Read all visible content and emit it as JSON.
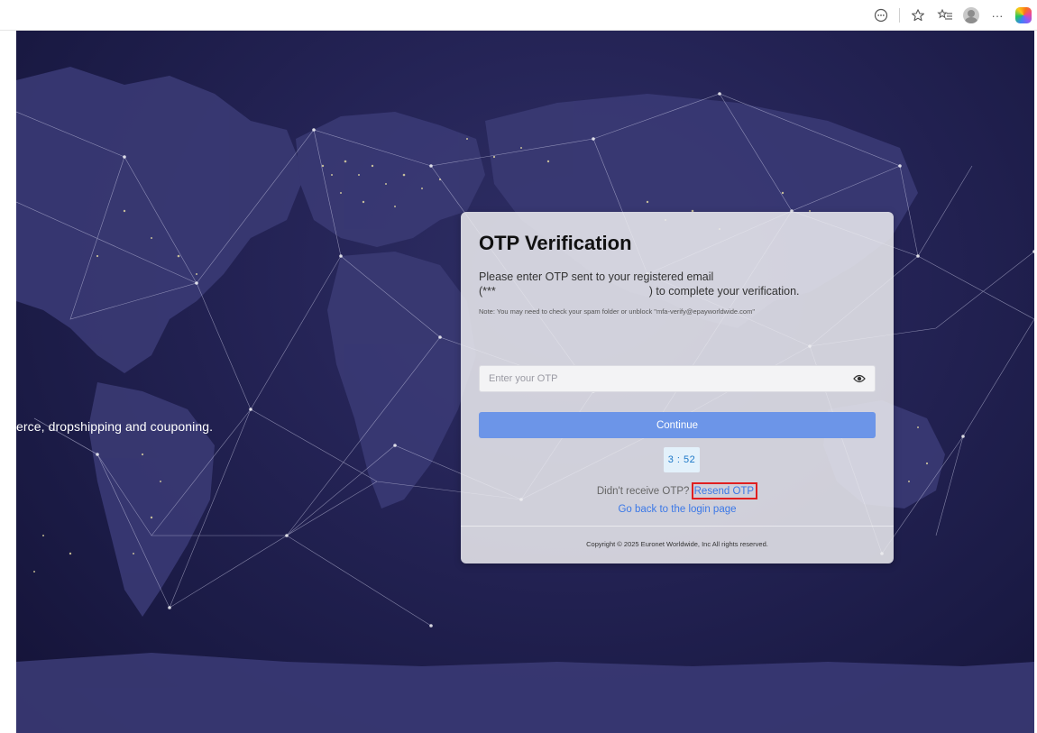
{
  "browser": {
    "icons": [
      "more-circle-icon",
      "star-icon",
      "favorites-icon",
      "profile-icon",
      "menu-dots-icon",
      "copilot-icon"
    ],
    "menu_dots": "···"
  },
  "page": {
    "hero_text": "erce, dropshipping and couponing."
  },
  "otp_card": {
    "title": "OTP Verification",
    "instruction_line1": "Please enter OTP sent to your registered email",
    "instruction_line2_prefix": "(***",
    "instruction_line2_suffix": ") to complete your verification.",
    "note": "Note: You may need to check your spam folder or unblock \"mfa-verify@epayworldwide.com\"",
    "input_placeholder": "Enter your OTP",
    "input_value": "",
    "continue_label": "Continue",
    "timer": "3 : 52",
    "resend_prompt": "Didn't receive OTP?",
    "resend_label": "Resend OTP",
    "back_label": "Go back to the login page",
    "copyright": "Copyright © 2025 Euronet Worldwide, Inc All rights reserved."
  },
  "colors": {
    "background": "#242355",
    "button": "#6c95e8",
    "link": "#3b78e7",
    "timer_bg": "#e3f1fb",
    "timer_text": "#1d78c8",
    "highlight": "#e02020"
  }
}
